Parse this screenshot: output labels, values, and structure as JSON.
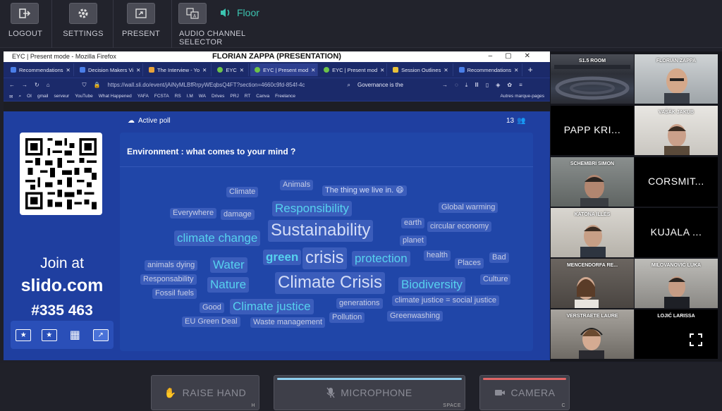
{
  "topbar": {
    "logout": "LOGOUT",
    "settings": "SETTINGS",
    "present": "PRESENT",
    "audio": "AUDIO CHANNEL SELECTOR",
    "channel": "Floor"
  },
  "browser": {
    "window_title": "EYC | Present mode - Mozilla Firefox",
    "presenter": "FLORIAN ZAPPA (PRESENTATION)",
    "tabs": [
      {
        "label": "Recommendations",
        "color": "#4a7ee8"
      },
      {
        "label": "Decision Makers Vi",
        "color": "#4a7ee8"
      },
      {
        "label": "The Interview - Yo",
        "color": "#e8a33a"
      },
      {
        "label": "EYC",
        "color": "#6cc24a"
      },
      {
        "label": "EYC | Present mod",
        "color": "#6cc24a"
      },
      {
        "label": "EYC | Present mod",
        "color": "#6cc24a"
      },
      {
        "label": "Session Outlines",
        "color": "#e8c13a"
      },
      {
        "label": "Recommendations",
        "color": "#4a7ee8"
      }
    ],
    "url": "https://wall.sli.do/event/jAiNyMLBfRrpyWEqbsQ4FT?section=4660c9fd-854f-4c",
    "search": "Governance is the",
    "bookmarks": [
      "OI",
      "gmail",
      "serveur",
      "YouTube",
      "What Happened",
      "YAFA",
      "FCSTA",
      "RS",
      "I.M",
      "WA",
      "Drives",
      "PRJ",
      "RT",
      "Canva",
      "Freelance",
      "Autres marque-pages"
    ]
  },
  "slido": {
    "join_at": "Join at",
    "site": "slido.com",
    "code": "#335 463",
    "active_poll": "Active poll",
    "count": "13",
    "question": "Environment : what comes to your mind ?"
  },
  "wordcloud": [
    {
      "text": "Animals"
    },
    {
      "text": "Climate"
    },
    {
      "text": "The thing we live in. 😄"
    },
    {
      "text": "Responsibility"
    },
    {
      "text": "Global warming"
    },
    {
      "text": "Everywhere"
    },
    {
      "text": "damage"
    },
    {
      "text": "Sustainability"
    },
    {
      "text": "earth"
    },
    {
      "text": "circular economy"
    },
    {
      "text": "climate change"
    },
    {
      "text": "planet"
    },
    {
      "text": "green"
    },
    {
      "text": "crisis"
    },
    {
      "text": "protection"
    },
    {
      "text": "health"
    },
    {
      "text": "Bad"
    },
    {
      "text": "animals dying"
    },
    {
      "text": "Water"
    },
    {
      "text": "Places"
    },
    {
      "text": "Responsability"
    },
    {
      "text": "Climate Crisis"
    },
    {
      "text": "Biodiversity"
    },
    {
      "text": "Culture"
    },
    {
      "text": "Nature"
    },
    {
      "text": "Fossil fuels"
    },
    {
      "text": "Good"
    },
    {
      "text": "Climate justice"
    },
    {
      "text": "generations"
    },
    {
      "text": "climate justice = social justice"
    },
    {
      "text": "EU Green Deal"
    },
    {
      "text": "Waste management"
    },
    {
      "text": "Pollution"
    },
    {
      "text": "Greenwashing"
    }
  ],
  "participants": {
    "room": "S1.5 ROOM",
    "zappa": "FLORIAN ZAPPA",
    "papp": "PAPP KRI...",
    "vasak": "VAŠÁK JAKUB",
    "schembri": "SCHEMBRI SIMON",
    "corsmit": "CORSMIT...",
    "katona": "KATONA ILLÉS",
    "kujala": "KUJALA ...",
    "mencendorfa": "MENCENDORFA RE...",
    "milovanovic": "MILOVANOVIĆ LUKA",
    "verstraete": "VERSTRAETE LAURE",
    "lojic": "LOJIĆ LARISSA"
  },
  "bottombar": {
    "raise_hand": "RAISE HAND",
    "raise_key": "H",
    "microphone": "MICROPHONE",
    "mic_key": "SPACE",
    "camera": "CAMERA",
    "cam_key": "C",
    "mic_accent": "#8fd0f0",
    "cam_accent": "#e06666"
  }
}
